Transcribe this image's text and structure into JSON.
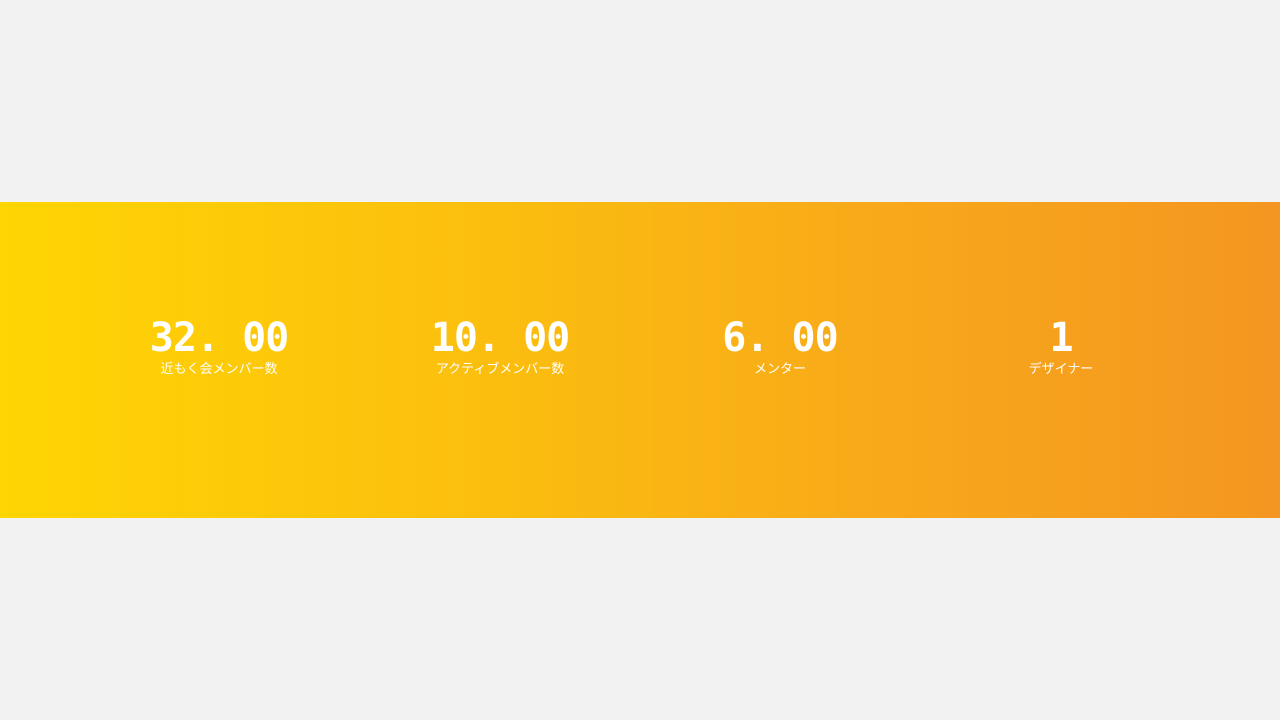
{
  "stats": [
    {
      "value": "32. 00",
      "label": "近もく会メンバー数"
    },
    {
      "value": "10. 00",
      "label": "アクティブメンバー数"
    },
    {
      "value": "6. 00",
      "label": "メンター"
    },
    {
      "value": "1",
      "label": "デザイナー"
    }
  ],
  "colors": {
    "background": "#f2f2f2",
    "band_start": "#ffd503",
    "band_end": "#f49621",
    "text": "#ffffff"
  }
}
